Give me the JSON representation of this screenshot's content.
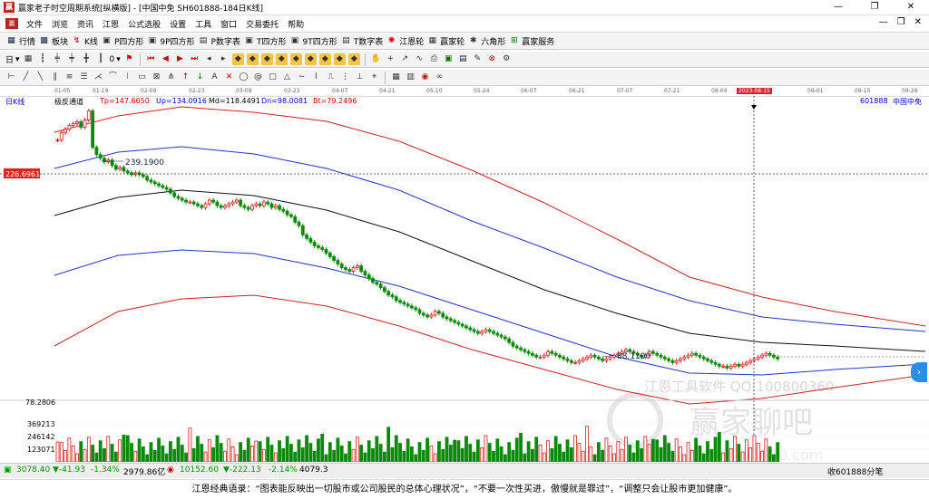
{
  "window": {
    "title": "赢家老子时空周期系统[纵横版] - [中国中免  SH601888-184日K线]",
    "controls": [
      "—",
      "❐",
      "✕"
    ]
  },
  "menu": {
    "items": [
      "文件",
      "浏览",
      "资讯",
      "江恩",
      "公式选股",
      "设置",
      "工具",
      "窗口",
      "交易委托",
      "帮助"
    ],
    "right": [
      "—",
      "❐",
      "✕"
    ]
  },
  "toolbar1": {
    "items": [
      {
        "label": "行情",
        "icon": "grid-icon"
      },
      {
        "label": "板块",
        "icon": "blocks-icon"
      },
      {
        "label": "K线",
        "icon": "candles-icon"
      },
      {
        "label": "P四方形",
        "icon": "square-p-icon"
      },
      {
        "label": "9P四方形",
        "icon": "square-9p-icon"
      },
      {
        "label": "P数字表",
        "icon": "table-p-icon"
      },
      {
        "label": "T四方形",
        "icon": "square-t-icon"
      },
      {
        "label": "9T四方形",
        "icon": "square-9t-icon"
      },
      {
        "label": "T数字表",
        "icon": "table-t-icon"
      },
      {
        "label": "江恩轮",
        "icon": "wheel-icon"
      },
      {
        "label": "赢家轮",
        "icon": "wheel2-icon"
      },
      {
        "label": "六角形",
        "icon": "hexagon-icon"
      },
      {
        "label": "赢家服务",
        "icon": "service-icon"
      }
    ]
  },
  "toolbar2": {
    "period": "日",
    "zero": "0"
  },
  "date_axis": {
    "labels": [
      "01-05",
      "01-19",
      "02-09",
      "02-23",
      "03-09",
      "03-23",
      "04-07",
      "04-21",
      "05-10",
      "05-24",
      "06-07",
      "06-21",
      "07-07",
      "07-21",
      "08-04",
      "09-01",
      "09-15",
      "09-29"
    ],
    "highlight": "2023-08-15"
  },
  "info": {
    "period_label": "日K线",
    "indicator": "极反通道",
    "tp": "Tp=147.6650",
    "up": "Up=134.0916",
    "md": "Md=118.4491",
    "dn": "Dn=98.0081",
    "bt": "Bt=79.2496",
    "code": "601888",
    "name": "中国中免"
  },
  "price_labels": {
    "cursor_price": "226.6961",
    "high": "239.1900",
    "low": "88.1100",
    "bottom": "78.2806"
  },
  "volume_axis": [
    "369213",
    "246142",
    "123071"
  ],
  "watermark": {
    "line1": "江恩工具软件  QQ:100800360",
    "line2": "赢家聊吧",
    "line3": "liaoba.yj1360.com"
  },
  "status": {
    "sh_index": "3078.40",
    "sh_change": "▼-41.93",
    "sh_pct": "-1.34%",
    "sh_amount": "2979.86亿",
    "sz_index": "10152.60",
    "sz_change": "▼-222.13",
    "sz_pct": "-2.14%",
    "sz_amount": "4079.3",
    "right": "收601888分笔"
  },
  "quote": "江恩经典语录：“图表能反映出一切股市或公司股民的总体心理状况”，“不要一次性买进，傲慢就是罪过”，“调整只会让股市更加健康”。",
  "colors": {
    "up": "#d22020",
    "down": "#0a8a0a",
    "channel_outer": "#cc2222",
    "channel_inner": "#2233cc",
    "channel_mid": "#111111"
  },
  "chart_data": {
    "type": "candlestick",
    "title": "",
    "price_range": [
      78.2806,
      239.19
    ],
    "series": [
      {
        "name": "Tp",
        "last": 147.665
      },
      {
        "name": "Up",
        "last": 134.0916
      },
      {
        "name": "Md",
        "last": 118.4491
      },
      {
        "name": "Dn",
        "last": 98.0081
      },
      {
        "name": "Bt",
        "last": 79.2496
      }
    ],
    "closes": [
      222,
      226,
      228,
      230,
      231,
      232,
      229,
      233,
      238,
      218,
      214,
      212,
      210,
      211,
      208,
      206,
      207,
      205,
      204,
      203,
      204,
      203,
      202,
      200,
      199,
      198,
      197,
      196,
      195,
      193,
      191,
      190,
      189,
      188,
      188,
      187,
      186,
      185,
      187,
      189,
      188,
      186,
      185,
      186,
      187,
      188,
      189,
      186,
      185,
      184,
      186,
      187,
      186,
      188,
      187,
      185,
      186,
      184,
      183,
      181,
      180,
      177,
      175,
      170,
      168,
      166,
      164,
      163,
      162,
      160,
      158,
      156,
      154,
      152,
      151,
      150,
      152,
      153,
      150,
      148,
      146,
      144,
      143,
      141,
      139,
      137,
      136,
      134,
      133,
      132,
      131,
      130,
      129,
      127,
      126,
      125,
      126,
      128,
      127,
      125,
      124,
      123,
      122,
      121,
      120,
      119,
      118,
      117,
      116,
      117,
      118,
      117,
      116,
      115,
      114,
      113,
      111,
      109,
      108,
      107,
      106,
      105,
      104,
      103,
      103,
      104,
      106,
      105,
      104,
      103,
      102,
      101,
      100,
      100,
      101,
      102,
      103,
      104,
      103,
      102,
      101,
      102,
      103,
      104,
      105,
      106,
      107,
      106,
      105,
      104,
      103,
      104,
      106,
      105,
      104,
      103,
      102,
      101,
      100,
      101,
      102,
      103,
      104,
      105,
      104,
      103,
      102,
      101,
      100,
      99,
      98,
      98,
      97,
      98,
      99,
      98,
      99,
      100,
      101,
      102,
      103,
      104,
      105,
      104,
      103,
      102
    ]
  }
}
